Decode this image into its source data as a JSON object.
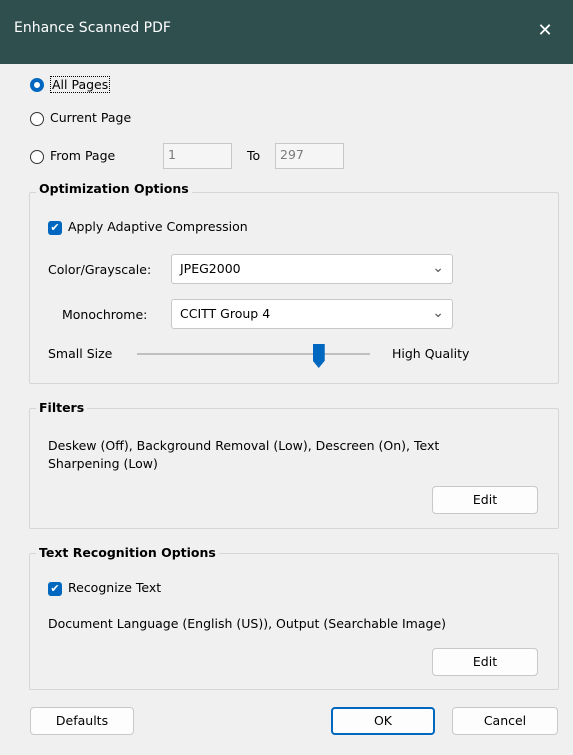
{
  "window": {
    "title": "Enhance Scanned PDF",
    "close_glyph": "✕"
  },
  "pages": {
    "all_label": "All Pages",
    "current_label": "Current Page",
    "from_label": "From Page",
    "from_value": "1",
    "to_label": "To",
    "to_value": "297",
    "selected": "all"
  },
  "optimization": {
    "title": "Optimization Options",
    "adaptive_label": "Apply Adaptive Compression",
    "color_label": "Color/Grayscale:",
    "color_value": "JPEG2000",
    "mono_label": "Monochrome:",
    "mono_value": "CCITT Group 4",
    "small_label": "Small Size",
    "high_label": "High Quality",
    "quality_level": 0.78
  },
  "filters": {
    "title": "Filters",
    "summary": "Deskew (Off), Background Removal (Low), Descreen (On), Text Sharpening (Low)",
    "edit_label": "Edit"
  },
  "ocr": {
    "title": "Text Recognition Options",
    "recognize_label": "Recognize Text",
    "summary": "Document Language (English (US)), Output (Searchable Image)",
    "edit_label": "Edit"
  },
  "footer": {
    "defaults_label": "Defaults",
    "ok_label": "OK",
    "cancel_label": "Cancel"
  },
  "colors": {
    "title_bar": "#2f4f4f",
    "accent": "#0067c0"
  },
  "icons": {
    "close": "close-icon",
    "chevron": "chevron-down-icon",
    "check": "check-icon"
  }
}
